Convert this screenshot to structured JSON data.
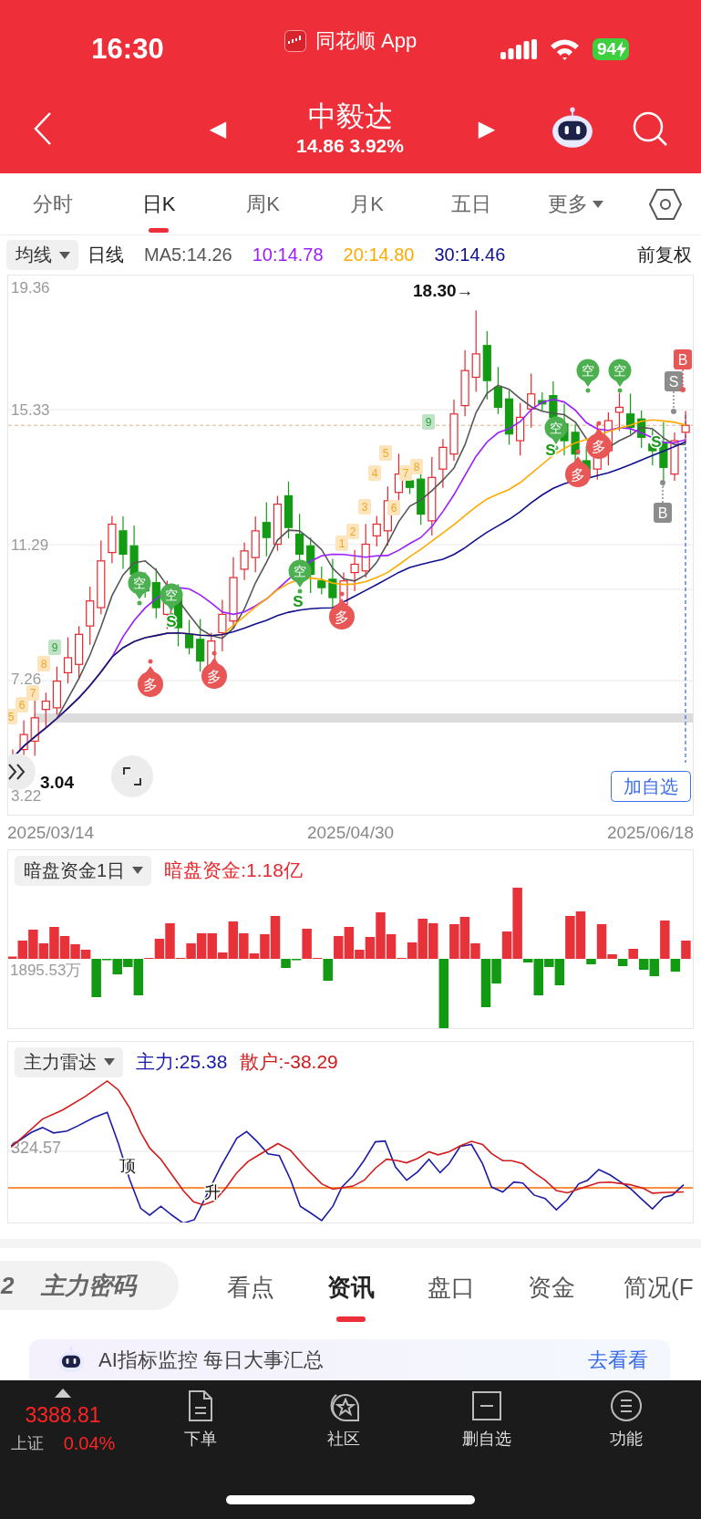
{
  "status_bar": {
    "time": "16:30",
    "app_name": "同花顺 App",
    "battery": "94"
  },
  "header": {
    "title": "中毅达",
    "quote": "14.86 3.92%",
    "prev": "◀",
    "next": "▶"
  },
  "period_tabs": [
    {
      "label": "分时",
      "selected": false,
      "dropdown": false
    },
    {
      "label": "日K",
      "selected": true,
      "dropdown": false
    },
    {
      "label": "周K",
      "selected": false,
      "dropdown": false
    },
    {
      "label": "月K",
      "selected": false,
      "dropdown": false
    },
    {
      "label": "五日",
      "selected": false,
      "dropdown": false
    },
    {
      "label": "更多",
      "selected": false,
      "dropdown": true
    }
  ],
  "indicator_bar": {
    "selector": "均线",
    "period": "日线",
    "ma": [
      {
        "text": "MA5:14.26",
        "color": "#555555"
      },
      {
        "text": "10:14.78",
        "color": "#9b1cff"
      },
      {
        "text": "20:14.80",
        "color": "#ffaa00"
      },
      {
        "text": "30:14.46",
        "color": "#10108f"
      }
    ],
    "adjust": "前复权"
  },
  "kline": {
    "y_ticks": [
      "19.36",
      "15.33",
      "11.29",
      "7.26",
      "3.22"
    ],
    "high_label": "18.30→",
    "low_label": "3.04",
    "signals": [
      {
        "kind": "short",
        "text": "空",
        "color": "#4caf50"
      },
      {
        "kind": "short",
        "text": "空",
        "color": "#4caf50"
      },
      {
        "kind": "short",
        "text": "空",
        "color": "#4caf50"
      },
      {
        "kind": "short",
        "text": "空",
        "color": "#4caf50"
      },
      {
        "kind": "short",
        "text": "空",
        "color": "#4caf50"
      },
      {
        "kind": "short",
        "text": "空",
        "color": "#4caf50"
      },
      {
        "kind": "long",
        "text": "多",
        "color": "#e85656"
      },
      {
        "kind": "long",
        "text": "多",
        "color": "#e85656"
      },
      {
        "kind": "long",
        "text": "多",
        "color": "#e85656"
      },
      {
        "kind": "long",
        "text": "多",
        "color": "#e85656"
      },
      {
        "kind": "long",
        "text": "多",
        "color": "#e85656"
      },
      {
        "kind": "count",
        "text": "5",
        "color": "#f5a623"
      },
      {
        "kind": "count",
        "text": "6",
        "color": "#f5a623"
      },
      {
        "kind": "count",
        "text": "7",
        "color": "#f5a623"
      },
      {
        "kind": "count",
        "text": "8",
        "color": "#f5a623"
      },
      {
        "kind": "count",
        "text": "9",
        "color": "#2e9e3e"
      },
      {
        "kind": "count",
        "text": "1",
        "color": "#f5a623"
      },
      {
        "kind": "count",
        "text": "2",
        "color": "#f5a623"
      },
      {
        "kind": "count",
        "text": "3",
        "color": "#f5a623"
      },
      {
        "kind": "count",
        "text": "4",
        "color": "#f5a623"
      },
      {
        "kind": "count",
        "text": "5",
        "color": "#f5a623"
      },
      {
        "kind": "count",
        "text": "6",
        "color": "#f5a623"
      },
      {
        "kind": "count",
        "text": "7",
        "color": "#f5a623"
      },
      {
        "kind": "count",
        "text": "8",
        "color": "#f5a623"
      },
      {
        "kind": "count",
        "text": "9",
        "color": "#2e9e3e"
      },
      {
        "kind": "letter",
        "text": "S",
        "color": "#1a9a1a"
      },
      {
        "kind": "letter",
        "text": "S",
        "color": "#1a9a1a"
      },
      {
        "kind": "letter",
        "text": "S",
        "color": "#1a9a1a"
      },
      {
        "kind": "letter",
        "text": "S",
        "color": "#1a9a1a"
      },
      {
        "kind": "box",
        "text": "S",
        "color": "#8c8c8c"
      },
      {
        "kind": "box",
        "text": "B",
        "color": "#e85656"
      },
      {
        "kind": "box",
        "text": "B",
        "color": "#8c8c8c"
      }
    ],
    "add_button": "加自选",
    "dates": [
      "2025/03/14",
      "2025/04/30",
      "2025/06/18"
    ]
  },
  "dark_pool": {
    "selector": "暗盘资金1日",
    "readout": "暗盘资金:1.18亿",
    "axis_label": "1895.53万"
  },
  "radar": {
    "selector": "主力雷达",
    "readouts": [
      {
        "text": "主力:25.38",
        "color": "#1c1ca6"
      },
      {
        "text": "散户:-38.29",
        "color": "#d11a1a"
      }
    ],
    "axis_label": "324.57",
    "markers": [
      "顶",
      "升"
    ]
  },
  "detail_tabs": {
    "feature": {
      "cut_text": "2",
      "label": "主力密码"
    },
    "tabs": [
      {
        "label": "看点",
        "selected": false
      },
      {
        "label": "资讯",
        "selected": true
      },
      {
        "label": "盘口",
        "selected": false
      },
      {
        "label": "资金",
        "selected": false
      },
      {
        "label": "简况(F",
        "selected": false
      }
    ]
  },
  "banner": {
    "text": "AI指标监控 每日大事汇总",
    "link": "去看看"
  },
  "bottom_bar": {
    "index": {
      "value": "3388.81",
      "name": "上证",
      "change": "0.04%"
    },
    "items": [
      {
        "kind": "order",
        "label": "下单"
      },
      {
        "kind": "community",
        "label": "社区"
      },
      {
        "kind": "unwatch",
        "label": "删自选"
      },
      {
        "kind": "menu",
        "label": "功能"
      }
    ]
  }
}
